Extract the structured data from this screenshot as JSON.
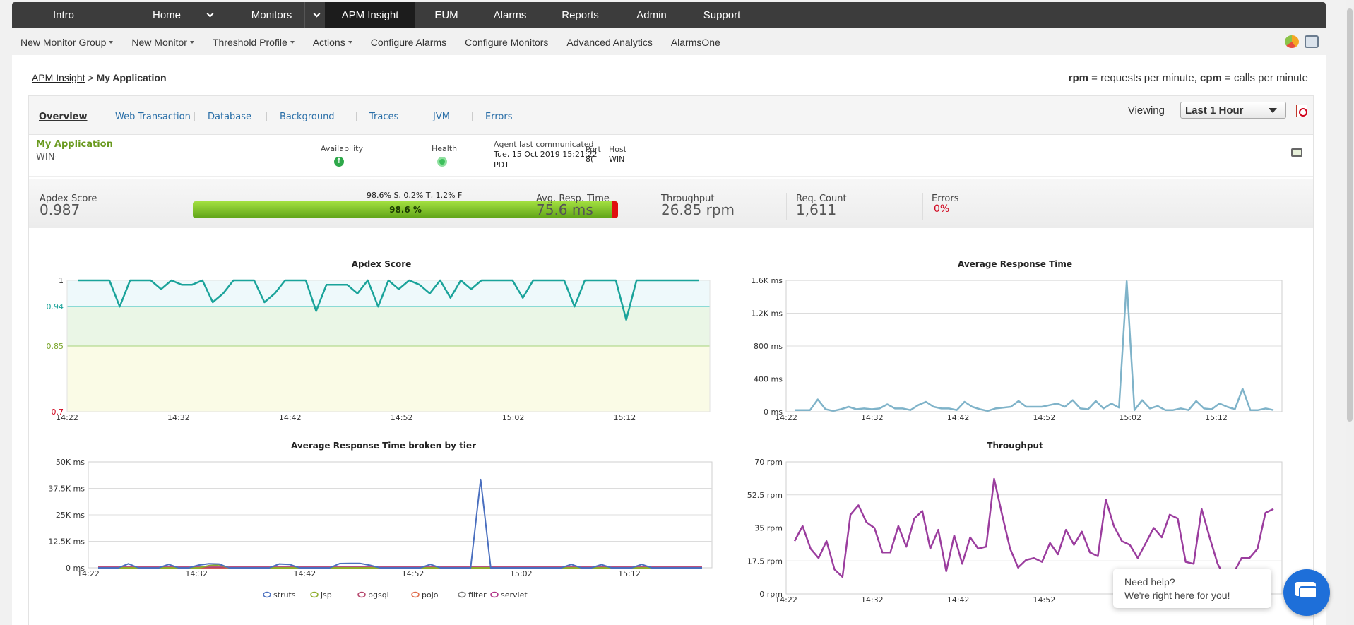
{
  "nav": {
    "items": [
      {
        "label": "Intro",
        "w": 146,
        "caret": false
      },
      {
        "label": "Home",
        "w": 146,
        "caret": true
      },
      {
        "label": "Monitors",
        "w": 151,
        "caret": true
      },
      {
        "label": "APM Insight",
        "w": 128,
        "caret": false,
        "active": true
      },
      {
        "label": "EUM",
        "w": 88,
        "caret": false
      },
      {
        "label": "Alarms",
        "w": 92,
        "caret": false
      },
      {
        "label": "Reports",
        "w": 107,
        "caret": false
      },
      {
        "label": "Admin",
        "w": 95,
        "caret": false
      },
      {
        "label": "Support",
        "w": 104,
        "caret": false
      }
    ]
  },
  "subnav": {
    "items": [
      {
        "label": "New Monitor Group",
        "caret": true
      },
      {
        "label": "New Monitor",
        "caret": true
      },
      {
        "label": "Threshold Profile",
        "caret": true
      },
      {
        "label": "Actions",
        "caret": true
      },
      {
        "label": "Configure Alarms",
        "caret": false
      },
      {
        "label": "Configure Monitors",
        "caret": false
      },
      {
        "label": "Advanced Analytics",
        "caret": false
      },
      {
        "label": "AlarmsOne",
        "caret": false
      }
    ]
  },
  "breadcrumb": {
    "root": "APM Insight",
    "sep": ">",
    "current": "My Application"
  },
  "legend_note": {
    "rpm": "rpm",
    "rpm_desc": " = requests per minute, ",
    "cpm": "cpm",
    "cpm_desc": " = calls per minute"
  },
  "tabs": [
    "Overview",
    "Web Transaction",
    "Database",
    "Background",
    "Traces",
    "JVM",
    "Errors"
  ],
  "viewing": {
    "label": "Viewing",
    "value": "Last 1 Hour"
  },
  "app": {
    "name": "My Application",
    "host_prefix": "WIN-",
    "availability_label": "Availability",
    "health_label": "Health",
    "agent_label": "Agent last communicated",
    "agent_time": "Tue, 15 Oct 2019 15:21:22",
    "agent_tz": "PDT",
    "port_label": "Port",
    "port_value": "8(",
    "host_label": "Host",
    "host_value": "WIN"
  },
  "kpis": {
    "apdex_label": "Apdex Score",
    "apdex_value": "0.987",
    "apdex_split": "98.6% S, 0.2% T, 1.2% F",
    "apdex_bar_label": "98.6 %",
    "satisfied_pct": 98.6,
    "frustrated_pct": 1.4,
    "resp_label": "Avg. Resp. Time",
    "resp_value": "75.6 ms",
    "throughput_label": "Throughput",
    "throughput_value": "26.85 rpm",
    "req_label": "Req. Count",
    "req_value": "1,611",
    "errors_label": "Errors",
    "errors_value": "0%"
  },
  "colors": {
    "accent": "#1aa39a",
    "resp": "#7fb3c9",
    "throughput": "#9b3d9e",
    "error": "#d0021b"
  },
  "chart_data": [
    {
      "type": "line",
      "title": "Apdex Score",
      "x": [
        "14:22",
        "14:32",
        "14:42",
        "14:52",
        "15:02",
        "15:12"
      ],
      "ylim": [
        0.7,
        1
      ],
      "yticks": [
        "1",
        "0.94",
        "0.85",
        "0.7"
      ],
      "thresholds": [
        0.94,
        0.85
      ],
      "series": [
        {
          "values": [
            1,
            1,
            1,
            1,
            0.94,
            1,
            1,
            1,
            0.98,
            1,
            0.99,
            0.99,
            1,
            0.95,
            0.97,
            1,
            1,
            1,
            0.95,
            0.97,
            1,
            1,
            1,
            0.93,
            0.99,
            0.99,
            0.99,
            0.97,
            1,
            0.94,
            1,
            0.98,
            1,
            0.99,
            0.97,
            1,
            0.96,
            1,
            0.98,
            1,
            1,
            1,
            1,
            0.96,
            1,
            1,
            1,
            1,
            0.94,
            1,
            1,
            1,
            1,
            0.91,
            1,
            1,
            1,
            1,
            1,
            1,
            1
          ]
        }
      ]
    },
    {
      "type": "line",
      "title": "Average Response Time",
      "x": [
        "14:22",
        "14:32",
        "14:42",
        "14:52",
        "15:02",
        "15:12"
      ],
      "ylim": [
        0,
        1600
      ],
      "yticks": [
        "1.6K ms",
        "1.2K ms",
        "800 ms",
        "400 ms",
        "0 ms"
      ],
      "series": [
        {
          "values": [
            20,
            20,
            20,
            150,
            30,
            10,
            30,
            60,
            30,
            40,
            30,
            40,
            90,
            40,
            40,
            20,
            80,
            120,
            60,
            40,
            40,
            20,
            120,
            60,
            30,
            10,
            40,
            50,
            60,
            130,
            60,
            60,
            60,
            80,
            100,
            60,
            140,
            40,
            30,
            130,
            40,
            100,
            50,
            1590,
            20,
            140,
            40,
            70,
            20,
            20,
            40,
            20,
            130,
            40,
            30,
            100,
            60,
            30,
            280,
            20,
            20,
            40,
            20
          ]
        }
      ]
    },
    {
      "type": "line",
      "title": "Average Response Time broken by tier",
      "x": [
        "14:22",
        "14:32",
        "14:42",
        "14:52",
        "15:02",
        "15:12"
      ],
      "ylim": [
        0,
        50000
      ],
      "yticks": [
        "50K ms",
        "37.5K ms",
        "25K ms",
        "12.5K ms",
        "0 ms"
      ],
      "series": [
        {
          "name": "struts",
          "values": [
            0,
            0,
            0,
            1900,
            0,
            0,
            0,
            1600,
            0,
            0,
            1300,
            1900,
            1800,
            0,
            0,
            0,
            0,
            0,
            1800,
            1600,
            0,
            0,
            0,
            0,
            2000,
            2100,
            2100,
            1200,
            0,
            0,
            0,
            0,
            0,
            1600,
            0,
            0,
            0,
            0,
            41700,
            0,
            0,
            0,
            0,
            0,
            0,
            0,
            0,
            1600,
            0,
            0,
            1500,
            0,
            0,
            0,
            1600,
            0,
            0,
            0,
            0,
            0,
            0
          ]
        },
        {
          "name": "jsp",
          "values": [
            0,
            0,
            0,
            0,
            0,
            0,
            0,
            0,
            0,
            0,
            0,
            1000,
            1400,
            0,
            0,
            0,
            0,
            0,
            0,
            0,
            0,
            0,
            0,
            0,
            0,
            0,
            0,
            0,
            0,
            0,
            0,
            0,
            0,
            0,
            0,
            0,
            0,
            0,
            0,
            0,
            0,
            0,
            0,
            0,
            0,
            0,
            0,
            0,
            0,
            0,
            0,
            0,
            0,
            0,
            0,
            0,
            0,
            0,
            0,
            0,
            0
          ]
        },
        {
          "name": "pgsql",
          "values": [
            200,
            200,
            200,
            200,
            200,
            200,
            200,
            200,
            200,
            200,
            200,
            200,
            200,
            200,
            200,
            200,
            200,
            200,
            200,
            200,
            200,
            200,
            200,
            200,
            200,
            200,
            200,
            200,
            200,
            200,
            200,
            200,
            200,
            200,
            200,
            200,
            200,
            200,
            200,
            200,
            200,
            200,
            200,
            200,
            200,
            200,
            200,
            200,
            200,
            200,
            200,
            200,
            200,
            200,
            200,
            200,
            200,
            200,
            200,
            200,
            200
          ]
        },
        {
          "name": "pojo",
          "values": [
            0,
            0,
            0,
            0,
            0,
            0,
            0,
            0,
            0,
            0,
            0,
            0,
            0,
            0,
            0,
            0,
            0,
            0,
            0,
            0,
            0,
            0,
            0,
            0,
            0,
            0,
            0,
            0,
            0,
            0,
            0,
            0,
            0,
            0,
            0,
            0,
            0,
            0,
            0,
            0,
            0,
            0,
            0,
            0,
            0,
            0,
            0,
            0,
            0,
            0,
            0,
            0,
            0,
            0,
            0,
            0,
            0,
            0,
            0,
            0,
            0
          ]
        },
        {
          "name": "filter",
          "values": [
            100,
            100,
            100,
            100,
            100,
            100,
            100,
            100,
            100,
            100,
            100,
            100,
            100,
            100,
            100,
            100,
            100,
            100,
            100,
            100,
            100,
            100,
            100,
            100,
            100,
            100,
            100,
            100,
            100,
            100,
            100,
            100,
            100,
            100,
            100,
            100,
            100,
            100,
            100,
            100,
            100,
            100,
            100,
            100,
            100,
            100,
            100,
            100,
            100,
            100,
            100,
            100,
            100,
            100,
            100,
            100,
            100,
            100,
            100,
            100,
            100
          ]
        },
        {
          "name": "servlet",
          "values": [
            300,
            300,
            300,
            300,
            300,
            300,
            300,
            300,
            300,
            300,
            300,
            300,
            300,
            300,
            300,
            300,
            300,
            300,
            300,
            300,
            300,
            300,
            300,
            300,
            300,
            300,
            300,
            300,
            300,
            300,
            300,
            300,
            300,
            300,
            300,
            300,
            300,
            300,
            300,
            300,
            300,
            300,
            300,
            300,
            300,
            300,
            300,
            300,
            300,
            300,
            300,
            300,
            300,
            300,
            300,
            300,
            300,
            300,
            300,
            300,
            300
          ]
        }
      ]
    },
    {
      "type": "line",
      "title": "Throughput",
      "x": [
        "14:22",
        "14:32",
        "14:42",
        "14:52",
        "15:02",
        "15:12"
      ],
      "ylim": [
        0,
        70
      ],
      "yticks": [
        "70 rpm",
        "52.5 rpm",
        "35 rpm",
        "17.5 rpm",
        "0 rpm"
      ],
      "series": [
        {
          "values": [
            28,
            36,
            24,
            19,
            28,
            13,
            9,
            42,
            47,
            38,
            35,
            22,
            22,
            36,
            25,
            40,
            44,
            24,
            34,
            12,
            31,
            16,
            30,
            24,
            25,
            61,
            42,
            24,
            14,
            18,
            19,
            17,
            27,
            21,
            34,
            26,
            33,
            22,
            20,
            50,
            36,
            28,
            26,
            19,
            27,
            35,
            30,
            42,
            40,
            17,
            16,
            45,
            30,
            16,
            8,
            11,
            19,
            19,
            24,
            43,
            45
          ]
        }
      ]
    }
  ],
  "chart_legend": [
    "struts",
    "jsp",
    "pgsql",
    "pojo",
    "filter",
    "servlet"
  ],
  "chat": {
    "line1": "Need help?",
    "line2": "We're right here for you!"
  }
}
